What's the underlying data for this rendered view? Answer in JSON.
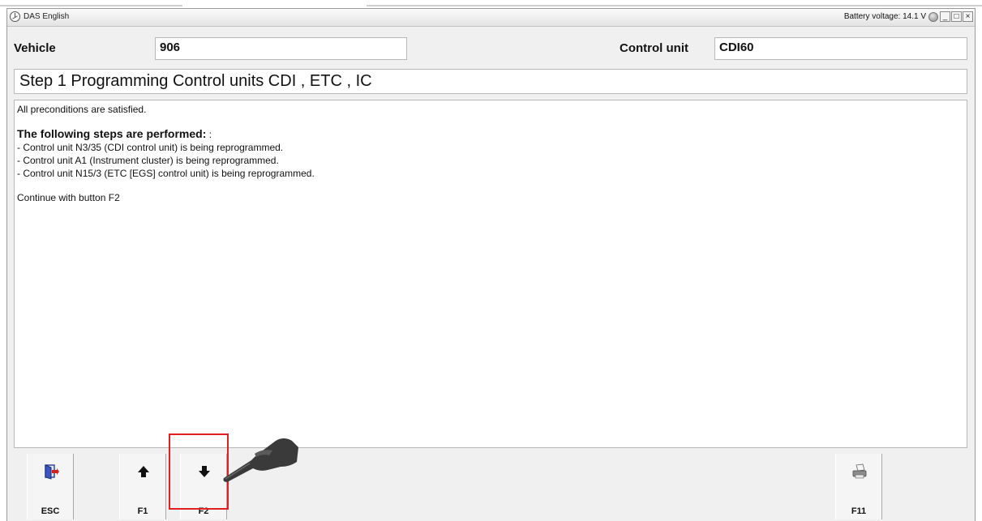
{
  "window": {
    "title": "DAS English",
    "battery_text": "Battery voltage: 14.1 V",
    "controls": {
      "minimize": "_",
      "maximize": "□",
      "close": "×"
    }
  },
  "header": {
    "vehicle_label": "Vehicle",
    "vehicle_value": "906",
    "control_unit_label": "Control unit",
    "control_unit_value": "CDI60"
  },
  "step_title": "Step 1 Programming Control units CDI , ETC , IC",
  "content": {
    "line1": "All preconditions are satisfied.",
    "steps_heading": "The following steps are performed:",
    "steps_heading_suffix": " :",
    "steps": [
      "- Control unit N3/35 (CDI control unit) is being reprogrammed.",
      "- Control unit A1 (Instrument cluster) is being reprogrammed.",
      "- Control unit N15/3 (ETC [EGS] control unit) is being reprogrammed."
    ],
    "continue_text": "Continue with button F2"
  },
  "function_keys": [
    {
      "label": "ESC",
      "icon": "exit-door-icon"
    },
    {
      "label": "F1",
      "icon": "arrow-up-icon"
    },
    {
      "label": "F2",
      "icon": "arrow-down-icon"
    },
    {
      "label": "F11",
      "icon": "printer-icon"
    }
  ],
  "colors": {
    "highlight": "#e02020",
    "window_bg": "#f0f0f0"
  }
}
